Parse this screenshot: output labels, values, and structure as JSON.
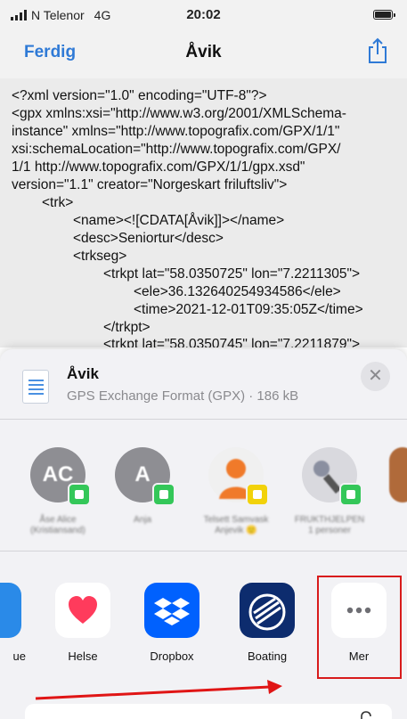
{
  "status_bar": {
    "carrier": "N Telenor",
    "network": "4G",
    "time": "20:02"
  },
  "nav": {
    "done_label": "Ferdig",
    "title": "Åvik"
  },
  "xml_lines": [
    "<?xml version=\"1.0\" encoding=\"UTF-8\"?>",
    "<gpx xmlns:xsi=\"http://www.w3.org/2001/XMLSchema-",
    "instance\" xmlns=\"http://www.topografix.com/GPX/1/1\"",
    "xsi:schemaLocation=\"http://www.topografix.com/GPX/",
    "1/1 http://www.topografix.com/GPX/1/1/gpx.xsd\"",
    "version=\"1.1\" creator=\"Norgeskart friluftsliv\">",
    "<trk>",
    "<name><![CDATA[Åvik]]></name>",
    "<desc>Seniortur</desc>",
    "<trkseg>",
    "<trkpt lat=\"58.0350725\" lon=\"7.2211305\">",
    "<ele>36.132640254934586</ele>",
    "<time>2021-12-01T09:35:05Z</time>",
    "</trkpt>",
    "<trkpt lat=\"58.0350745\" lon=\"7.2211879\">"
  ],
  "share_sheet": {
    "file_name": "Åvik",
    "file_meta": "GPS Exchange Format (GPX) · 186 kB",
    "close_symbol": "✕",
    "contacts": [
      {
        "initials": "AC",
        "name": "Åse Alice\n(Kristiansand)",
        "avatar_color": "#8e8e93",
        "badge_color": "#34c759"
      },
      {
        "initials": "A",
        "name": "Anja",
        "avatar_color": "#8e8e93",
        "badge_color": "#34c759"
      },
      {
        "initials": "",
        "name": "Telsett Samvask\nAnjevik 🙂",
        "avatar_color": "#f0f0f0",
        "badge_color": "#f2d20a"
      },
      {
        "initials": "",
        "name": "FRUKTHJELPEN\n1 personer",
        "avatar_color": "#d9d9de",
        "badge_color": "#34c759"
      }
    ],
    "apps": [
      {
        "label": "ue",
        "icon": "app-icon-partial"
      },
      {
        "label": "Helse",
        "icon": "heart-icon"
      },
      {
        "label": "Dropbox",
        "icon": "dropbox-icon"
      },
      {
        "label": "Boating",
        "icon": "navionics-icon"
      },
      {
        "label": "Mer",
        "icon": "more-icon"
      }
    ]
  },
  "colors": {
    "accent": "#2f7ad6",
    "highlight": "#d81b1b",
    "dropbox": "#0061fe"
  }
}
